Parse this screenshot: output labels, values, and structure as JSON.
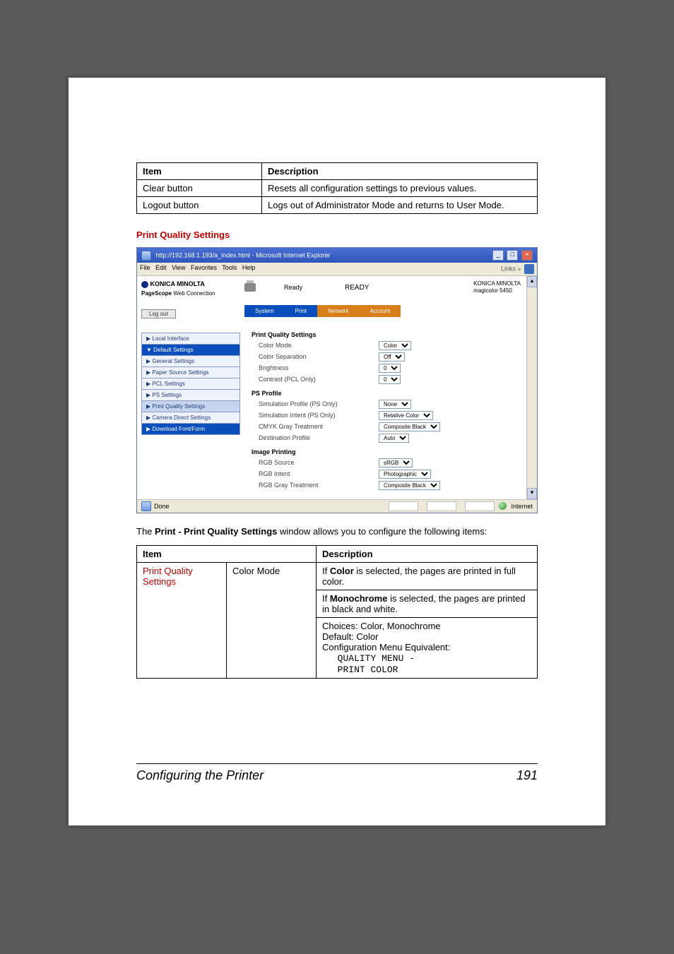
{
  "table1": {
    "headers": [
      "Item",
      "Description"
    ],
    "rows": [
      {
        "item": "Clear button",
        "desc": "Resets all configuration settings to previous values."
      },
      {
        "item": "Logout button",
        "desc": "Logs out of Administrator Mode and returns to User Mode."
      }
    ]
  },
  "section_title": "Print Quality Settings",
  "screenshot": {
    "title": "http://192.168.1.193/a_index.html - Microsoft Internet Explorer",
    "menus": [
      "File",
      "Edit",
      "View",
      "Favorites",
      "Tools",
      "Help"
    ],
    "links_label": "Links",
    "brand": "KONICA MINOLTA",
    "brand_sub": "PageScope Web Connection",
    "logout": "Log out",
    "status_ready_label": "Ready",
    "status_ready": "READY",
    "model_line1": "KONICA MINOLTA",
    "model_line2": "magicolor 5450",
    "tabs": [
      "System",
      "Print",
      "Network",
      "Account"
    ],
    "sidenav": [
      {
        "text": "▶ Local Interface",
        "kind": ""
      },
      {
        "text": "▼ Default Settings",
        "kind": "group"
      },
      {
        "text": "▶ General Settings",
        "kind": ""
      },
      {
        "text": "▶ Paper Source Settings",
        "kind": ""
      },
      {
        "text": "▶ PCL Settings",
        "kind": ""
      },
      {
        "text": "▶ PS Settings",
        "kind": ""
      },
      {
        "text": "▶ Print Quality Settings",
        "kind": "sel"
      },
      {
        "text": "▶ Camera Direct Settings",
        "kind": ""
      },
      {
        "text": "▶ Download Font/Form",
        "kind": "group"
      }
    ],
    "groups": [
      {
        "title": "Print Quality Settings",
        "rows": [
          {
            "label": "Color Mode",
            "value": "Color"
          },
          {
            "label": "Color Separation",
            "value": "Off"
          },
          {
            "label": "Brightness",
            "value": "0"
          },
          {
            "label": "Contrast (PCL Only)",
            "value": "0"
          }
        ]
      },
      {
        "title": "PS Profile",
        "rows": [
          {
            "label": "Simulation Profile (PS Only)",
            "value": "None"
          },
          {
            "label": "Simulation Intent (PS Only)",
            "value": "Relative Color"
          },
          {
            "label": "CMYK Gray Treatment",
            "value": "Composite Black"
          },
          {
            "label": "Destination Profile",
            "value": "Auto"
          }
        ]
      },
      {
        "title": "Image Printing",
        "rows": [
          {
            "label": "RGB Source",
            "value": "sRGB"
          },
          {
            "label": "RGB Intent",
            "value": "Photographic"
          },
          {
            "label": "RGB Gray Treatment",
            "value": "Composite Black"
          }
        ]
      }
    ],
    "status_done": "Done",
    "status_zone": "Internet"
  },
  "paragraph_prefix": "The ",
  "paragraph_bold": "Print - Print Quality Settings",
  "paragraph_suffix": " window allows you to configure the following items:",
  "table2": {
    "headers": [
      "Item",
      "Description"
    ],
    "row": {
      "item": "Print Quality Settings",
      "sub": "Color Mode",
      "desc_p1_a": "If ",
      "desc_p1_b": "Color",
      "desc_p1_c": " is selected, the pages are printed in full color.",
      "desc_p2_a": "If ",
      "desc_p2_b": "Monochrome",
      "desc_p2_c": " is selected, the pages are printed in black and white.",
      "choices": "Choices: Color, Monochrome",
      "default": "Default:  Color",
      "cfg": "Configuration Menu Equivalent:",
      "mono1": "QUALITY MENU -",
      "mono2": "PRINT COLOR"
    }
  },
  "footer_left": "Configuring the Printer",
  "footer_page": "191"
}
